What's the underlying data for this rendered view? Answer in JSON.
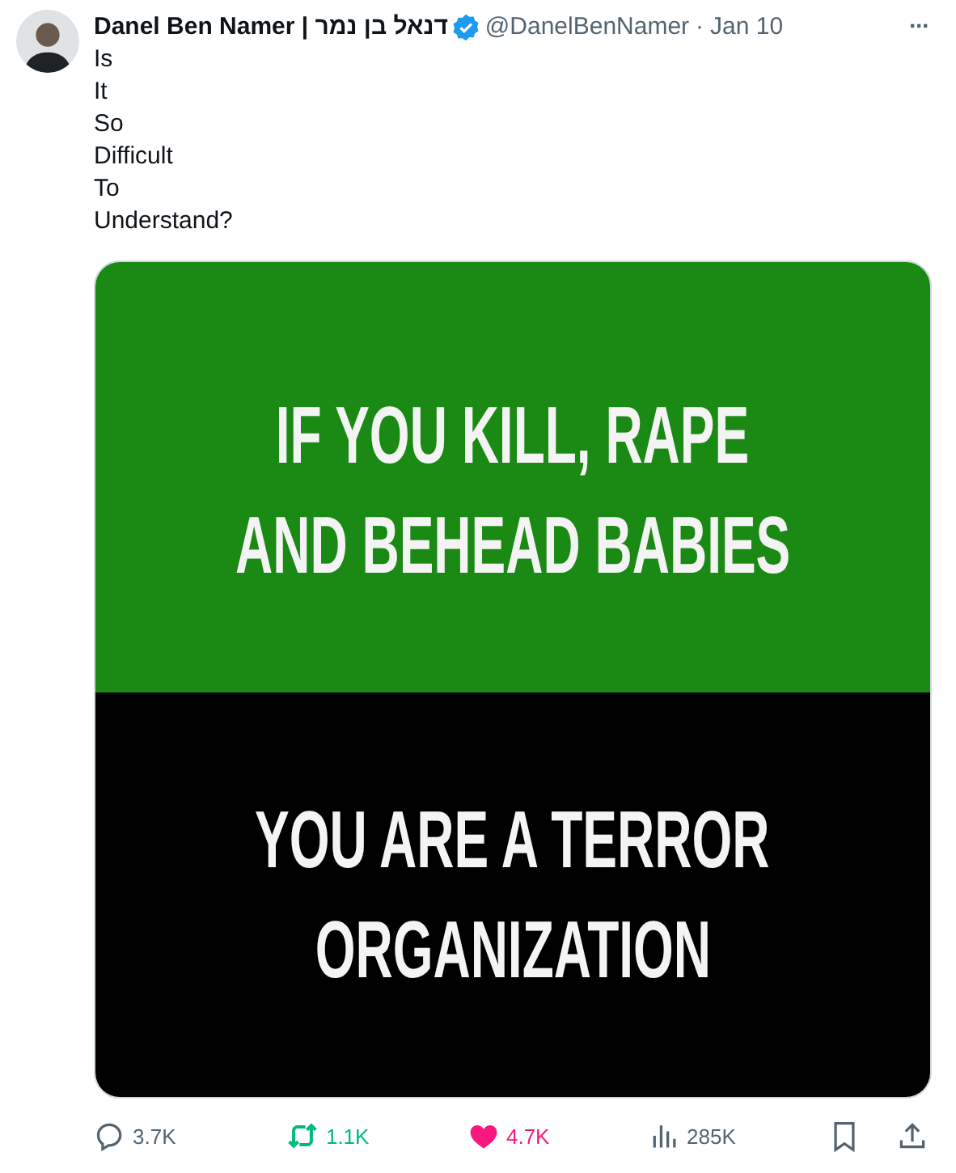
{
  "tweet": {
    "author": {
      "name": "Danel Ben Namer | דנאל בן נמר",
      "verified": true,
      "handle": "@DanelBenNamer",
      "separator": "·",
      "date": "Jan 10"
    },
    "more": "···",
    "text_lines": [
      "Is",
      "It",
      "So",
      "Difficult",
      "To",
      "Understand?"
    ],
    "media": {
      "panels": [
        {
          "color": "#1a8a14",
          "lines": [
            "IF YOU KILL, RAPE",
            "AND BEHEAD BABIES"
          ]
        },
        {
          "color": "#000000",
          "lines": [
            "YOU ARE A TERROR",
            "ORGANIZATION"
          ]
        }
      ]
    },
    "actions": [
      {
        "kind": "reply",
        "count": "3.7K"
      },
      {
        "kind": "retweet",
        "count": "1.1K",
        "selected": true
      },
      {
        "kind": "like",
        "count": "4.7K",
        "selected": true
      },
      {
        "kind": "views",
        "count": "285K"
      },
      {
        "kind": "bookmark",
        "selected": false
      },
      {
        "kind": "share"
      }
    ]
  }
}
